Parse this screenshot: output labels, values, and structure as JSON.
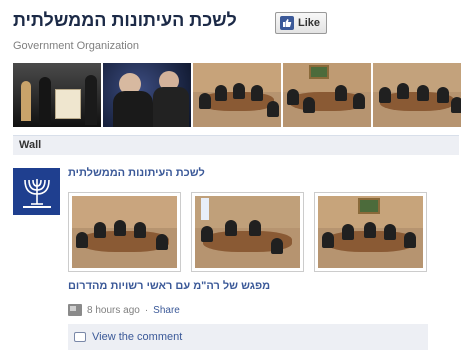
{
  "header": {
    "title": "לשכת העיתונות הממשלתית",
    "like_label": "Like",
    "subtitle": "Government Organization"
  },
  "strip": {
    "photos": [
      {
        "name": "photo-ceremony"
      },
      {
        "name": "photo-signing"
      },
      {
        "name": "photo-meeting-1"
      },
      {
        "name": "photo-meeting-2"
      },
      {
        "name": "photo-meeting-3"
      }
    ]
  },
  "wall": {
    "label": "Wall"
  },
  "post": {
    "author": "לשכת העיתונות הממשלתית",
    "album_title": "מפגש של רה\"מ עם ראשי רשויות מהדרום",
    "time": "8 hours ago",
    "separator": "·",
    "share": "Share",
    "view_comment": "View the comment"
  },
  "colors": {
    "link": "#3b5998",
    "title": "#1c2a47",
    "bar": "#edeff4",
    "avatar": "#1f3f8f"
  }
}
